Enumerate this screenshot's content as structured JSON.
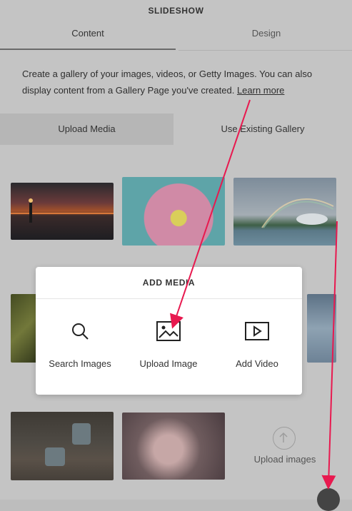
{
  "header": {
    "title": "SLIDESHOW"
  },
  "tabs": [
    {
      "label": "Content"
    },
    {
      "label": "Design"
    }
  ],
  "description": {
    "text": "Create a gallery of your images, videos, or Getty Images. You can also display content from a Gallery Page you've created.",
    "link": "Learn more"
  },
  "actions": {
    "upload_media": "Upload Media",
    "use_existing": "Use Existing Gallery"
  },
  "gallery": {
    "upload_label": "Upload images"
  },
  "modal": {
    "title": "ADD MEDIA",
    "options": [
      {
        "label": "Search Images",
        "icon": "search-icon"
      },
      {
        "label": "Upload Image",
        "icon": "image-icon"
      },
      {
        "label": "Add Video",
        "icon": "video-icon"
      }
    ]
  },
  "colors": {
    "annotation_arrow": "#e8194f"
  }
}
